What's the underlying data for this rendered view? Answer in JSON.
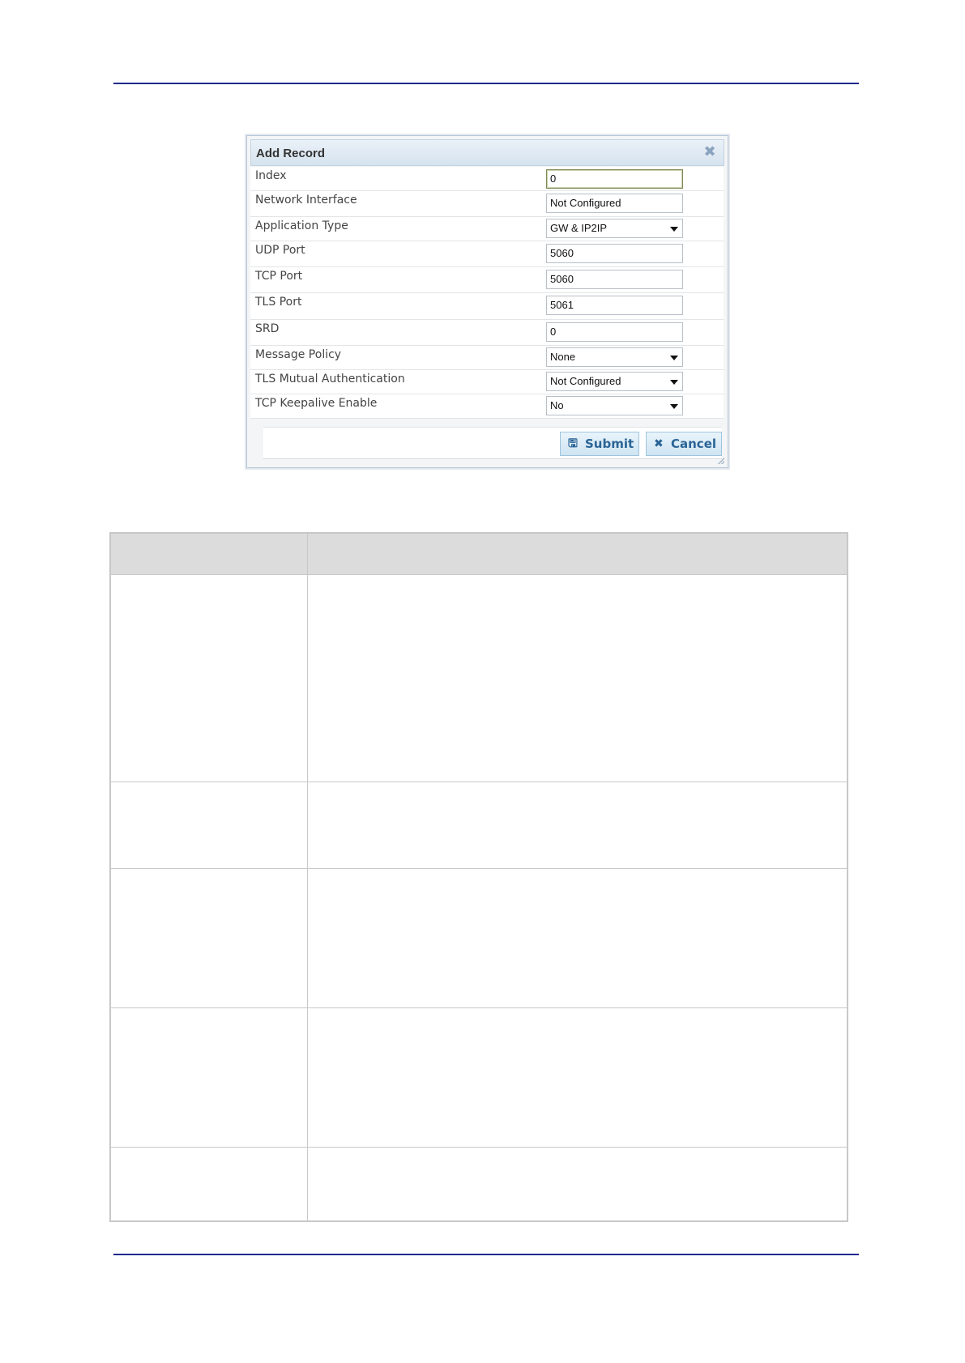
{
  "dialog": {
    "title": "Add Record",
    "close_icon": "close-icon",
    "fields": [
      {
        "label": "Index",
        "type": "text",
        "value": "0"
      },
      {
        "label": "Network Interface",
        "type": "text",
        "value": "Not Configured"
      },
      {
        "label": "Application Type",
        "type": "select",
        "value": "GW & IP2IP"
      },
      {
        "label": "UDP Port",
        "type": "text",
        "value": "5060"
      },
      {
        "label": "TCP Port",
        "type": "text",
        "value": "5060"
      },
      {
        "label": "TLS Port",
        "type": "text",
        "value": "5061"
      },
      {
        "label": "SRD",
        "type": "text",
        "value": "0"
      },
      {
        "label": "Message Policy",
        "type": "select",
        "value": "None"
      },
      {
        "label": "TLS Mutual Authentication",
        "type": "select",
        "value": "Not Configured"
      },
      {
        "label": "TCP Keepalive Enable",
        "type": "select",
        "value": "No"
      }
    ],
    "submit_label": "Submit",
    "cancel_label": "Cancel",
    "submit_icon": "save-icon",
    "cancel_icon": "close-icon",
    "colors": {
      "header": "#d6e3ef",
      "button_text": "#2a6496",
      "rule": "#1f2a8c"
    }
  }
}
